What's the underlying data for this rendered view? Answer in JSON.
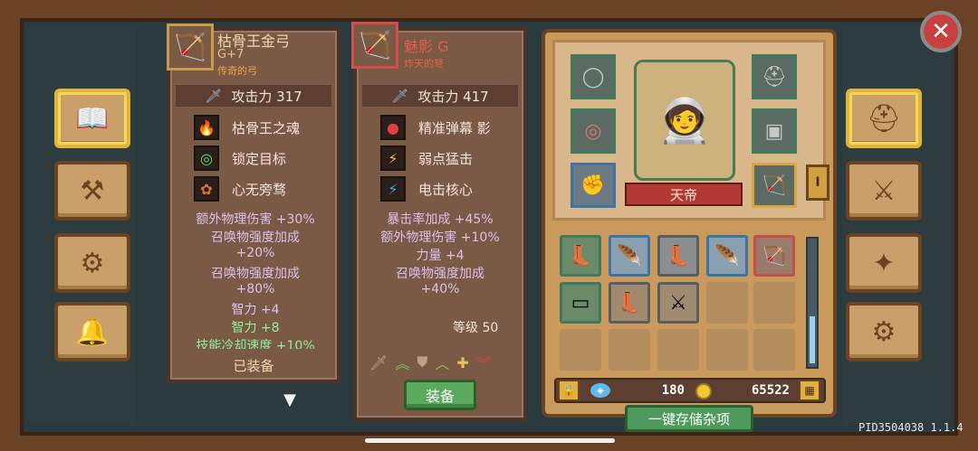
{
  "left_card": {
    "name": "枯骨王金弓",
    "level": "G+7",
    "rarity": "传奇的弓",
    "attack_label": "攻击力 317",
    "skills": [
      {
        "label": "枯骨王之魂",
        "icon": "purple-flame-icon"
      },
      {
        "label": "锁定目标",
        "icon": "target-icon"
      },
      {
        "label": "心无旁骛",
        "icon": "flower-icon"
      }
    ],
    "bonuses": [
      "额外物理伤害 +30%",
      "召唤物强度加成",
      "+20%",
      "召唤物强度加成",
      "+80%",
      "智力 +4"
    ],
    "green_bonuses": [
      "智力 +8",
      "技能冷却速度 +10%"
    ],
    "status_label": "已装备"
  },
  "right_card": {
    "name": "魅影 G",
    "rarity": "炸天的弩",
    "attack_label": "攻击力 417",
    "skills": [
      {
        "label": "精准弹幕 影",
        "icon": "red-drop-icon"
      },
      {
        "label": "弱点猛击",
        "icon": "lightning-slash-icon"
      },
      {
        "label": "电击核心",
        "icon": "blue-bolt-icon"
      }
    ],
    "bonuses": [
      "暴击率加成 +45%",
      "额外物理伤害 +10%",
      "力量 +4",
      "召唤物强度加成",
      "+40%"
    ],
    "level_label": "等级 50",
    "equip_button": "装备"
  },
  "character": {
    "name": "天帝",
    "slot_badge": "I"
  },
  "currency": {
    "gems": "180",
    "coins": "65522"
  },
  "store_button": "一键存储杂项",
  "version": "PID3504038 1.1.4",
  "colors": {
    "accent_gold": "#e0b53b",
    "close_red": "#c84040",
    "equip_green": "#5aa95c",
    "banner_red": "#b33a34"
  }
}
